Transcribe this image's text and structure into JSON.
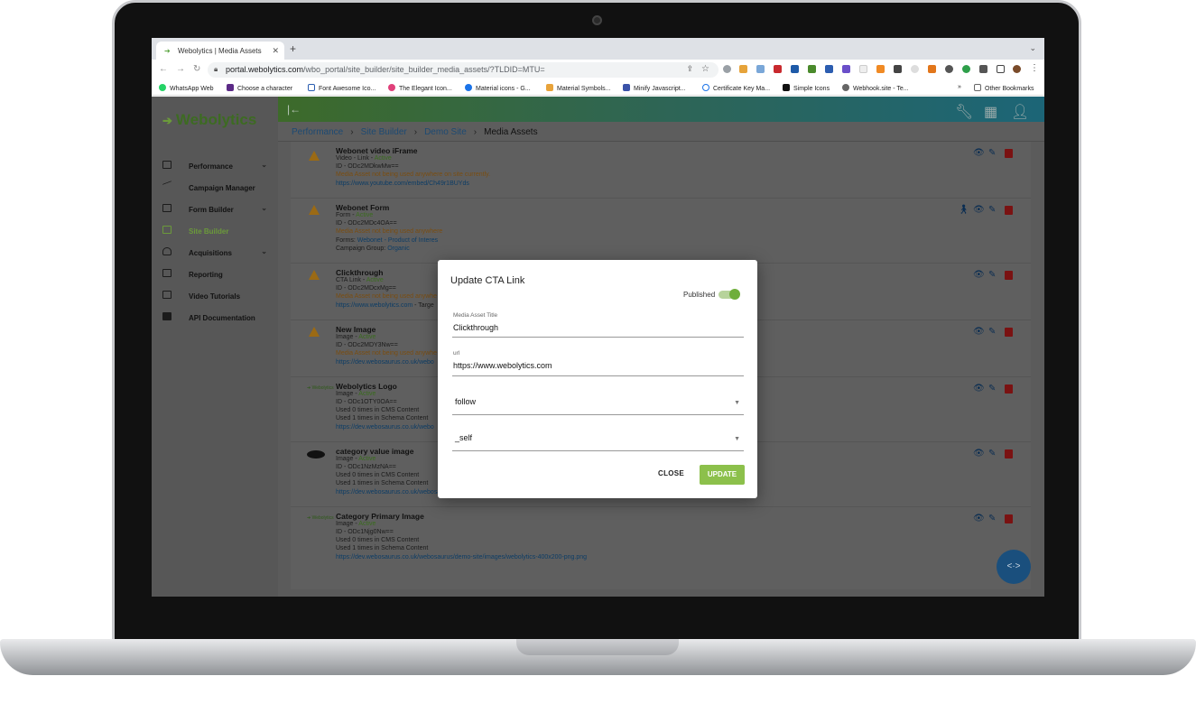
{
  "browser": {
    "tab_title": "Webolytics | Media Assets",
    "url_host": "portal.webolytics.com",
    "url_path": "/wbo_portal/site_builder/site_builder_media_assets/?TLDID=MTU=",
    "bookmarks": [
      "WhatsApp Web",
      "Choose a character",
      "Font Awesome Ico...",
      "The Elegant Icon...",
      "Material icons - G...",
      "Material Symbols...",
      "Minify Javascript...",
      "Certificate Key Ma...",
      "Simple Icons",
      "Webhook.site - Te..."
    ],
    "bookmark_more": "»",
    "other_bookmarks": "Other Bookmarks"
  },
  "sidebar": {
    "logo": "Webolytics",
    "items": [
      {
        "label": "Performance",
        "icon": "dashboard-icon"
      },
      {
        "label": "Campaign Manager",
        "icon": "trend-icon"
      },
      {
        "label": "Form Builder",
        "icon": "form-icon"
      },
      {
        "label": "Site Builder",
        "icon": "site-icon"
      },
      {
        "label": "Acquisitions",
        "icon": "people-icon"
      },
      {
        "label": "Reporting",
        "icon": "report-icon"
      },
      {
        "label": "Video Tutorials",
        "icon": "video-icon"
      },
      {
        "label": "API Documentation",
        "icon": "book-icon"
      }
    ]
  },
  "breadcrumb": [
    "Performance",
    "Site Builder",
    "Demo Site",
    "Media Assets"
  ],
  "assets": [
    {
      "title": "Webonet video iFrame",
      "type": "Video - Link - ",
      "status": "Active",
      "id": "ID - ODc2MDkwMw==",
      "l1": "Media Asset not being used anywhere on site currently.",
      "l2": "",
      "url": "https://www.youtube.com/embed/Ch49r1BUYds"
    },
    {
      "title": "Webonet Form",
      "type": "Form - ",
      "status": "Active",
      "id": "ID - ODc2MDc4OA==",
      "l1": "Media Asset not being used anywhere",
      "l2": "",
      "forms_label": "Forms: ",
      "forms_link": "Webonet - Product of Interes",
      "cg_label": "Campaign Group: ",
      "cg_link": "Organic"
    },
    {
      "title": "Clickthrough",
      "type": "CTA Link - ",
      "status": "Active",
      "id": "ID - ODc2MDcxMg==",
      "l1": "Media Asset not being used anywhe",
      "l2": "",
      "url": "https://www.webolytics.com",
      "url_suffix": " - Targe"
    },
    {
      "title": "New Image",
      "type": "Image - ",
      "status": "Active",
      "id": "ID - ODc2MDY3Nw==",
      "l1": "Media Asset not being used anywhe",
      "l2": "",
      "url": "https://dev.webosaurus.co.uk/webo"
    },
    {
      "title": "Webolytics Logo",
      "type": "Image - ",
      "status": "Active",
      "id": "ID - ODc1OTY0OA==",
      "l1": "Used 0 times in CMS Content",
      "l2": "Used 1 times in Schema Content",
      "url": "https://dev.webosaurus.co.uk/webo"
    },
    {
      "title": "category value image",
      "type": "Image - ",
      "status": "Active",
      "id": "ID - ODc1NzMzNA==",
      "l1": "Used 0 times in CMS Content",
      "l2": "Used 1 times in Schema Content",
      "url": "https://dev.webosaurus.co.uk/webosaurus/demo-site/images/agencies-1023x512-jpg.jpg"
    },
    {
      "title": "Category Primary Image",
      "type": "Image - ",
      "status": "Active",
      "id": "ID - ODc1Njg0Nw==",
      "l1": "Used 0 times in CMS Content",
      "l2": "Used 1 times in Schema Content",
      "url": "https://dev.webosaurus.co.uk/webosaurus/demo-site/images/webolytics-400x200-png.png"
    }
  ],
  "modal": {
    "title": "Update CTA Link",
    "published_label": "Published",
    "published": true,
    "title_label": "Media Asset Title",
    "title_value": "Clickthrough",
    "url_label": "url",
    "url_value": "https://www.webolytics.com",
    "rel_value": "follow",
    "target_value": "_self",
    "close_label": "CLOSE",
    "update_label": "UPDATE"
  },
  "fab_label": "<·>",
  "colors": {
    "accent": "#8cc04b",
    "link": "#1d4a73",
    "danger": "#7a1212"
  }
}
